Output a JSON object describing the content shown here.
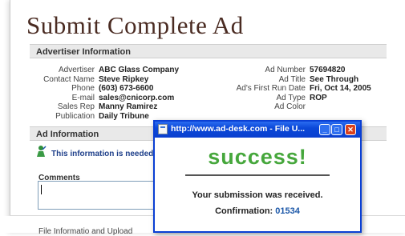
{
  "page_title": "Submit Complete Ad",
  "sections": {
    "advertiser": "Advertiser Information",
    "ad": "Ad Information"
  },
  "advertiser_left": [
    {
      "label": "Advertiser",
      "value": "ABC Glass Company"
    },
    {
      "label": "Contact Name",
      "value": "Steve Ripkey"
    },
    {
      "label": "Phone",
      "value": "(603) 673-6600"
    },
    {
      "label": "E-mail",
      "value": "sales@cnicorp.com"
    },
    {
      "label": "Sales Rep",
      "value": "Manny Ramirez"
    },
    {
      "label": "Publication",
      "value": "Daily Tribune"
    }
  ],
  "advertiser_right": [
    {
      "label": "Ad Number",
      "value": "57694820"
    },
    {
      "label": "Ad Title",
      "value": "See Through"
    },
    {
      "label": "Ad's First Run Date",
      "value": "Fri, Oct 14, 2005"
    },
    {
      "label": "Ad Type",
      "value": "ROP"
    },
    {
      "label": "Ad Color",
      "value": ""
    }
  ],
  "ad_info": {
    "note": "This information is needed to e",
    "comments_label": "Comments",
    "comments_value": "",
    "footer_text": "File Informatio and Upload"
  },
  "popup": {
    "title": "http://www.ad-desk.com - File U...",
    "heading": "success!",
    "message": "Your submission was received.",
    "confirmation_label": "Confirmation:",
    "confirmation_number": "01534",
    "accent_color": "#46a73c",
    "titlebar_color": "#0b48d8"
  }
}
